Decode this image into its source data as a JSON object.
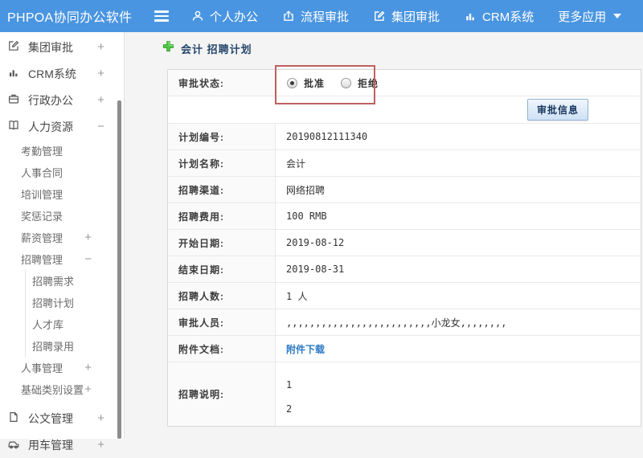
{
  "colors": {
    "topbar_blue": "#4a95e1",
    "highlight_red": "#c0605f",
    "link_blue": "#2d7bc4",
    "plus_green": "#4fc742",
    "button_text_navy": "#17365d"
  },
  "topbar": {
    "logo": "PHPOA协同办公软件",
    "nav": [
      {
        "label": "个人办公",
        "icon": "user-icon"
      },
      {
        "label": "流程审批",
        "icon": "process-icon"
      },
      {
        "label": "集团审批",
        "icon": "edit-square-icon"
      },
      {
        "label": "CRM系统",
        "icon": "bar-chart-icon"
      },
      {
        "label": "更多应用",
        "icon": "caret-down-icon"
      }
    ]
  },
  "sidebar": {
    "items": [
      {
        "label": "集团审批",
        "expand": "+",
        "level": 1,
        "icon": "edit-square-icon"
      },
      {
        "label": "CRM系统",
        "expand": "+",
        "level": 1,
        "icon": "bar-chart-icon"
      },
      {
        "label": "行政办公",
        "expand": "+",
        "level": 1,
        "icon": "briefcase-icon"
      },
      {
        "label": "人力资源",
        "expand": "−",
        "level": 1,
        "icon": "book-icon"
      },
      {
        "label": "考勤管理",
        "expand": "",
        "level": 2
      },
      {
        "label": "人事合同",
        "expand": "",
        "level": 2
      },
      {
        "label": "培训管理",
        "expand": "",
        "level": 2
      },
      {
        "label": "奖惩记录",
        "expand": "",
        "level": 2
      },
      {
        "label": "薪资管理",
        "expand": "+",
        "level": 2
      },
      {
        "label": "招聘管理",
        "expand": "−",
        "level": 2
      },
      {
        "label": "招聘需求",
        "expand": "",
        "level": 3
      },
      {
        "label": "招聘计划",
        "expand": "",
        "level": 3
      },
      {
        "label": "人才库",
        "expand": "",
        "level": 3
      },
      {
        "label": "招聘录用",
        "expand": "",
        "level": 3
      },
      {
        "label": "人事管理",
        "expand": "+",
        "level": 2
      },
      {
        "label": "基础类别设置",
        "expand": "+",
        "level": 2
      },
      {
        "label": "公文管理",
        "expand": "+",
        "level": 1,
        "icon": "document-icon"
      },
      {
        "label": "用车管理",
        "expand": "+",
        "level": 1,
        "icon": "car-icon"
      }
    ]
  },
  "main": {
    "title": "会计 招聘计划",
    "approval": {
      "label": "审批状态:",
      "options": [
        {
          "label": "批准",
          "selected": true
        },
        {
          "label": "拒绝",
          "selected": false
        }
      ]
    },
    "approve_button": "审批信息",
    "rows": [
      {
        "label": "计划编号:",
        "value": "20190812111340"
      },
      {
        "label": "计划名称:",
        "value": "会计"
      },
      {
        "label": "招聘渠道:",
        "value": "网络招聘"
      },
      {
        "label": "招聘费用:",
        "value": "100 RMB"
      },
      {
        "label": "开始日期:",
        "value": "2019-08-12"
      },
      {
        "label": "结束日期:",
        "value": "2019-08-31"
      },
      {
        "label": "招聘人数:",
        "value": "1 人"
      },
      {
        "label": "审批人员:",
        "value": ",,,,,,,,,,,,,,,,,,,,,,,,,小龙女,,,,,,,,"
      },
      {
        "label": "附件文档:",
        "value": "附件下载"
      }
    ],
    "description_row": {
      "label": "招聘说明:",
      "lines": [
        "1",
        "2"
      ]
    }
  }
}
